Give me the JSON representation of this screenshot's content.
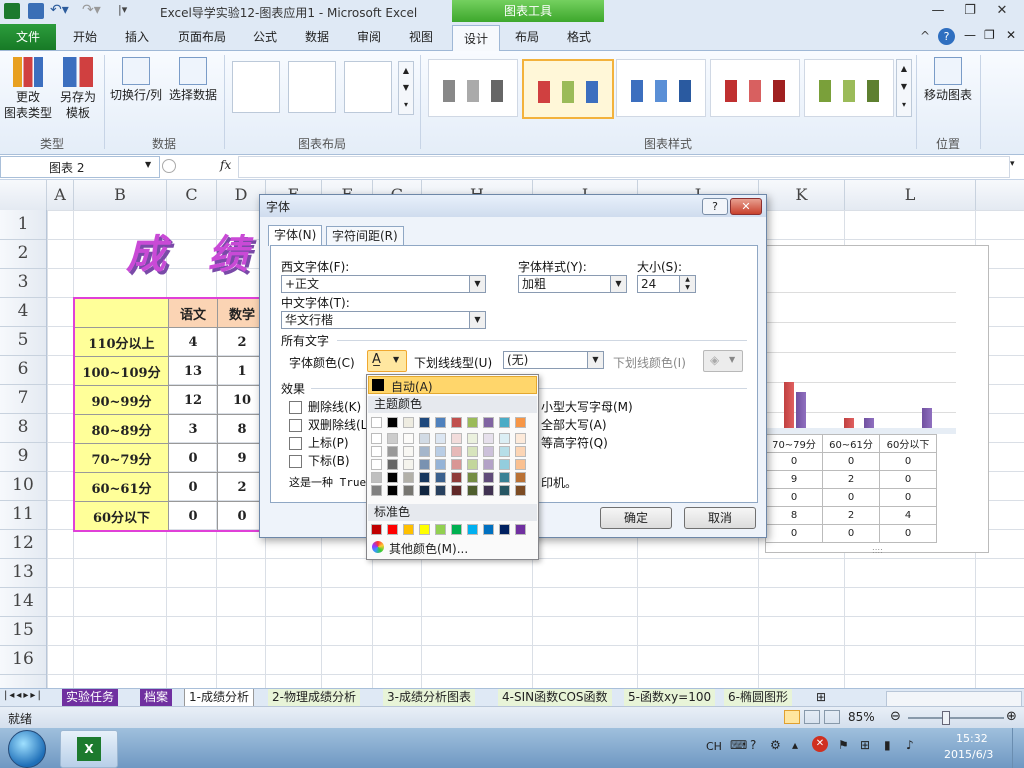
{
  "title": "Excel导学实验12-图表应用1 - Microsoft Excel",
  "contextual_tab": "图表工具",
  "ribbon_tabs": [
    "文件",
    "开始",
    "插入",
    "页面布局",
    "公式",
    "数据",
    "审阅",
    "视图",
    "设计",
    "布局",
    "格式"
  ],
  "ribbon": {
    "change_type": "更改\n图表类型",
    "save_template": "另存为\n模板",
    "switch_rowcol": "切换行/列",
    "select_data": "选择数据",
    "move_chart": "移动图表",
    "groups": [
      "类型",
      "数据",
      "图表布局",
      "图表样式",
      "位置"
    ]
  },
  "namebox": "图表 2",
  "fx": "fx",
  "columns": [
    "A",
    "B",
    "C",
    "D",
    "E",
    "F",
    "G",
    "H",
    "I",
    "J",
    "K",
    "L"
  ],
  "rows": [
    "1",
    "2",
    "3",
    "4",
    "5",
    "6",
    "7",
    "8",
    "9",
    "10",
    "11",
    "12",
    "13",
    "14",
    "15",
    "16"
  ],
  "sheet_title": "成 绩 统",
  "score_table": {
    "headers": [
      "",
      "语文",
      "数学"
    ],
    "rows": [
      [
        "110分以上",
        "4",
        "2"
      ],
      [
        "100~109分",
        "13",
        "1"
      ],
      [
        "90~99分",
        "12",
        "10"
      ],
      [
        "80~89分",
        "3",
        "8"
      ],
      [
        "70~79分",
        "0",
        "9"
      ],
      [
        "60~61分",
        "0",
        "2"
      ],
      [
        "60分以下",
        "0",
        "0"
      ]
    ]
  },
  "chart_mini_table": {
    "headers": [
      "70~79分",
      "60~61分",
      "60分以下"
    ],
    "rows": [
      [
        "0",
        "0",
        "0"
      ],
      [
        "9",
        "2",
        "0"
      ],
      [
        "0",
        "0",
        "0"
      ],
      [
        "8",
        "2",
        "4"
      ],
      [
        "0",
        "0",
        "0"
      ]
    ]
  },
  "dialog": {
    "title": "字体",
    "help": "?",
    "tabs": [
      "字体(N)",
      "字符间距(R)"
    ],
    "western_font_label": "西文字体(F):",
    "western_font_value": "+正文",
    "cjk_font_label": "中文字体(T):",
    "cjk_font_value": "华文行楷",
    "style_label": "字体样式(Y):",
    "style_value": "加粗",
    "size_label": "大小(S):",
    "size_value": "24",
    "all_text_label": "所有文字",
    "font_color_label": "字体颜色(C)",
    "underline_style_label": "下划线线型(U)",
    "underline_style_value": "(无)",
    "underline_color_label": "下划线颜色(I)",
    "effects_label": "效果",
    "effects": [
      "删除线(K)",
      "双删除线(L)",
      "上标(P)",
      "下标(B)"
    ],
    "effects_right": [
      "小型大写字母(M)",
      "全部大写(A)",
      "等高字符(Q)"
    ],
    "preview_text_left": "这是一种 True",
    "preview_text_right": "印机。",
    "ok": "确定",
    "cancel": "取消"
  },
  "color_popup": {
    "auto": "自动(A)",
    "theme_colors": "主题颜色",
    "standard_colors": "标准色",
    "more_colors": "其他颜色(M)...",
    "theme_top": [
      "#ffffff",
      "#000000",
      "#eeece1",
      "#1f497d",
      "#4f81bd",
      "#c0504d",
      "#9bbb59",
      "#8064a2",
      "#4bacc6",
      "#f79646"
    ],
    "standard": [
      "#c00000",
      "#ff0000",
      "#ffc000",
      "#ffff00",
      "#92d050",
      "#00b050",
      "#00b0f0",
      "#0070c0",
      "#002060",
      "#7030a0"
    ]
  },
  "sheet_tabs": [
    "实验任务",
    "档案",
    "1-成绩分析",
    "2-物理成绩分析",
    "3-成绩分析图表",
    "4-SIN函数COS函数",
    "5-函数xy=100",
    "6-椭圆图形"
  ],
  "status": {
    "ready": "就绪",
    "zoom": "85%"
  },
  "taskbar": {
    "lang": "CH",
    "time": "15:32",
    "date": "2015/6/3"
  }
}
